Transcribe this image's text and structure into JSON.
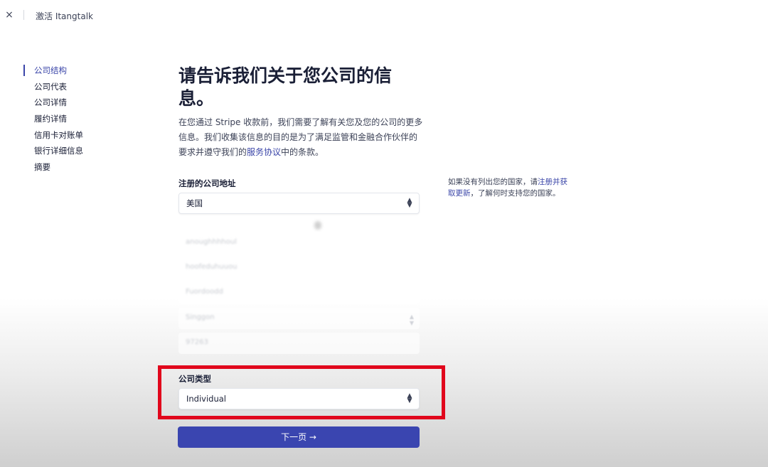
{
  "window": {
    "close_icon": "×",
    "title": "激活 Itangtalk"
  },
  "sidebar": {
    "items": [
      {
        "label": "公司结构",
        "active": true
      },
      {
        "label": "公司代表"
      },
      {
        "label": "公司详情"
      },
      {
        "label": "履约详情"
      },
      {
        "label": "信用卡对账单"
      },
      {
        "label": "银行详细信息"
      },
      {
        "label": "摘要"
      }
    ]
  },
  "main": {
    "heading": "请告诉我们关于您公司的信息。",
    "intro_before_link": "在您通过 Stripe 收款前，我们需要了解有关您及您的公司的更多信息。我们收集该信息的目的是为了满足监管和金融合作伙伴的要求并遵守我们的",
    "intro_link": "服务协议",
    "intro_after_link": "中的条款。",
    "address_label": "注册的公司地址",
    "country_value": "美国",
    "blurred_fields": [
      "anoughhhhoul",
      "hoofeduhuuou",
      "Fuordoodd",
      "Singgon",
      "97263"
    ],
    "note_before_link": "如果没有列出您的国家，请",
    "note_link": "注册并获取更新",
    "note_after_link": "，了解何时支持您的国家。",
    "company_type_label": "公司类型",
    "company_type_value": "Individual",
    "next_button": "下一页 →"
  },
  "colors": {
    "accent": "#3a45b0",
    "highlight": "#e1061c"
  }
}
